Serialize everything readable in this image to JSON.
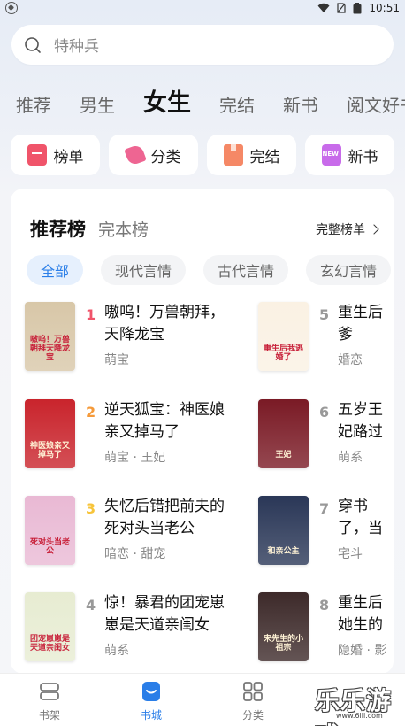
{
  "status_bar": {
    "time": "10:51"
  },
  "search": {
    "placeholder_text": "特种兵"
  },
  "channels": [
    {
      "label": "推荐",
      "active": false
    },
    {
      "label": "男生",
      "active": false
    },
    {
      "label": "女生",
      "active": true
    },
    {
      "label": "完结",
      "active": false
    },
    {
      "label": "新书",
      "active": false
    },
    {
      "label": "阅文好书",
      "active": false
    }
  ],
  "quick_entries": [
    {
      "label": "榜单",
      "icon": "rank-icon"
    },
    {
      "label": "分类",
      "icon": "category-icon"
    },
    {
      "label": "完结",
      "icon": "finished-icon"
    },
    {
      "label": "新书",
      "icon": "new-book-icon"
    }
  ],
  "rank_section": {
    "active_tab": "推荐榜",
    "other_tab": "完本榜",
    "full_rank_label": "完整榜单",
    "genres": [
      "全部",
      "现代言情",
      "古代言情",
      "玄幻言情"
    ],
    "active_genre": "全部",
    "books": [
      {
        "rank": "1",
        "title": "嗷呜！万兽朝拜，天降龙宝",
        "tags": "萌宝",
        "cover_color": "#d8c7a8",
        "cover_text": "嗷呜！万兽朝拜天降龙宝",
        "rank_color": "#f0546a"
      },
      {
        "rank": "2",
        "title": "逆天狐宝：神医娘亲又掉马了",
        "tags": "萌宝 · 王妃",
        "cover_color": "#c9242c",
        "cover_text": "神医娘亲又掉马了",
        "rank_color": "#f59a3a"
      },
      {
        "rank": "3",
        "title": "失忆后错把前夫的死对头当老公",
        "tags": "暗恋 · 甜宠",
        "cover_color": "#e9b9d4",
        "cover_text": "死对头当老公",
        "rank_color": "#f7c43a"
      },
      {
        "rank": "4",
        "title": "惊！暴君的团宠崽崽是天道亲闺女",
        "tags": "萌系",
        "cover_color": "#e7ecd2",
        "cover_text": "团宠崽崽是天道亲闺女",
        "rank_color": "#999999"
      },
      {
        "rank": "5",
        "title": "重生后爹",
        "tags": "婚恋",
        "cover_color": "#faf1e3",
        "cover_text": "重生后我逃婚了",
        "rank_color": "#999999"
      },
      {
        "rank": "6",
        "title": "五岁王妃路过都得",
        "tags": "萌系",
        "cover_color": "#7a1a25",
        "cover_text": "王妃",
        "rank_color": "#999999"
      },
      {
        "rank": "7",
        "title": "穿书了，当平妻",
        "tags": "宅斗",
        "cover_color": "#2a3757",
        "cover_text": "和亲公主",
        "rank_color": "#999999"
      },
      {
        "rank": "8",
        "title": "重生后她生的小祖宗",
        "tags": "隐婚 · 影",
        "cover_color": "#3d2a2a",
        "cover_text": "宋先生的小祖宗",
        "rank_color": "#999999"
      }
    ]
  },
  "bottom_nav": [
    {
      "label": "书架",
      "active": false,
      "icon": "bookshelf-icon"
    },
    {
      "label": "书城",
      "active": true,
      "icon": "bookstore-icon"
    },
    {
      "label": "分类",
      "active": false,
      "icon": "grid-icon"
    }
  ],
  "watermark": {
    "text": "乐乐游戏",
    "url": "www.6lll.com"
  }
}
